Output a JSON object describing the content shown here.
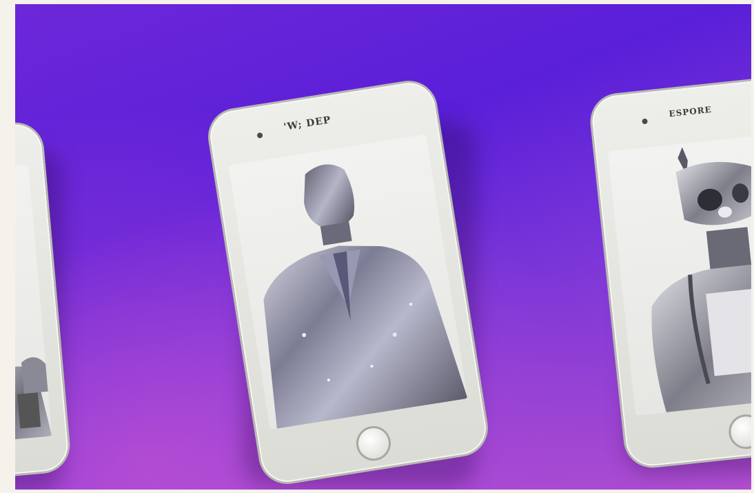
{
  "scene": {
    "description_colors": {
      "background_top": "#5a1fd8",
      "background_bottom": "#b24fd0",
      "phone_body": "#e6e6e1",
      "figure_metal": "#9c9cab"
    },
    "phones": [
      {
        "name": "left-phone-partial"
      },
      {
        "name": "center-phone",
        "speaker_label": "'W; DEP"
      },
      {
        "name": "right-phone",
        "speaker_label": "ESPORE"
      }
    ]
  }
}
